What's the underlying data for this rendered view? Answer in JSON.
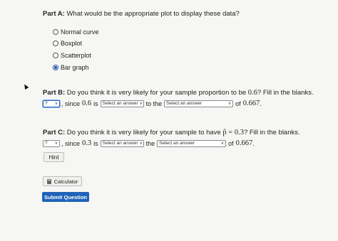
{
  "part_a": {
    "label": "Part A:",
    "question": "What would be the appropriate plot to display these data?",
    "options": [
      {
        "label": "Normal curve",
        "selected": false
      },
      {
        "label": "Boxplot",
        "selected": false
      },
      {
        "label": "Scatterplot",
        "selected": false
      },
      {
        "label": "Bar graph",
        "selected": true
      }
    ]
  },
  "part_b": {
    "label": "Part B:",
    "question_pre": "Do you think it is very likely for your sample proportion to be",
    "question_val": "0.6",
    "question_post": "? Fill in the blanks.",
    "select1_value": "?",
    "text1": ", since",
    "val1": "0.6",
    "text2": "is",
    "select2_value": "Select an answer",
    "text3": "to the",
    "select3_value": "Select an answer",
    "text4": "of",
    "val2": "0.667",
    "end": "."
  },
  "part_c": {
    "label": "Part C:",
    "question_pre": "Do you think it is very likely for your sample to have",
    "question_phat": "p̂",
    "question_eq": "= 0.3",
    "question_post": "? Fill in the blanks.",
    "select1_value": "?",
    "text1": ", since",
    "val1": "0.3",
    "text2": "is",
    "select2_value": "Select an answer",
    "text3": "the",
    "select3_value": "Select an answer",
    "text4": "of",
    "val2": "0.667",
    "end": "."
  },
  "buttons": {
    "hint": "Hint",
    "calculator": "Calculator",
    "submit": "Submit Question"
  }
}
